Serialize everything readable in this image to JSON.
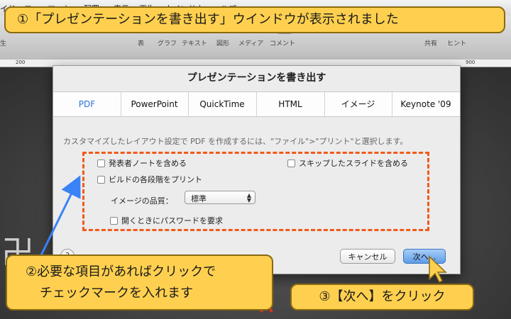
{
  "menubar": {
    "items": [
      "イド",
      "フォーマット",
      "配置",
      "表示",
      "再生",
      "ウインドウ",
      "ヘルプ"
    ]
  },
  "toolbar": {
    "items": [
      "表",
      "グラフ",
      "テキスト",
      "図形",
      "メディア",
      "コメント"
    ],
    "right_items": [
      "共有",
      "ヒント"
    ],
    "left_item": "生"
  },
  "ruler": {
    "left_mark": "200",
    "right_mark": "900"
  },
  "dialog": {
    "title": "プレゼンテーションを書き出す",
    "tabs": [
      "PDF",
      "PowerPoint",
      "QuickTime",
      "HTML",
      "イメージ",
      "Keynote '09"
    ],
    "active_tab": "PDF",
    "description": "カスタマイズしたレイアウト設定で PDF を作成するには、\"ファイル\">\"プリント\"と選択します。",
    "options": {
      "presenter_notes": "発表者ノートを含める",
      "skipped_slides": "スキップしたスライドを含める",
      "build_stages": "ビルドの各段階をプリント",
      "password": "開くときにパスワードを要求"
    },
    "quality_label": "イメージの品質：",
    "quality_value": "標準",
    "help_label": "?",
    "cancel_label": "キャンセル",
    "next_label": "次へ..."
  },
  "annotations": {
    "step1": "①「プレゼンテーションを書き出す」ウインドウが表示されました",
    "step2_line1": "②必要な項目があればクリックで",
    "step2_line2": "チェックマークを入れます",
    "step3": "③【次へ】をクリック"
  },
  "colors": {
    "callout_fill": "#ffd04f",
    "highlight_dash": "#f05a1a",
    "pointer_arrow": "#3b82f6",
    "active_tab": "#2f6fe0",
    "default_button": "#5e9ce8"
  }
}
